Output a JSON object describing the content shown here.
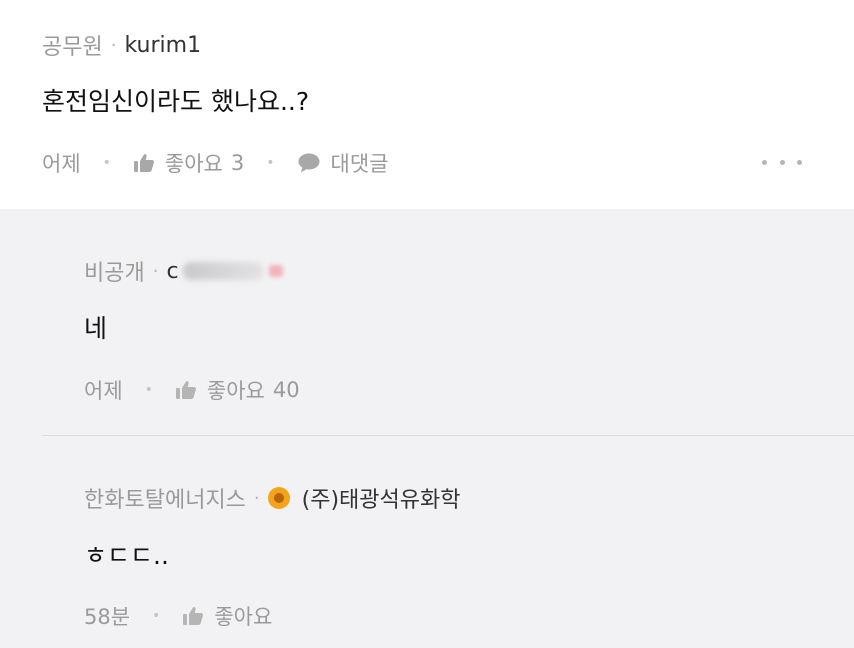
{
  "comment": {
    "job": "공무원",
    "author": "kurim1",
    "text": "혼전임신이라도 했나요..?",
    "time": "어제",
    "like_label": "좋아요",
    "like_count": "3",
    "reply_label": "대댓글",
    "more_icon": "more-dots-icon"
  },
  "replies": [
    {
      "company": "비공개",
      "author_visible": "c",
      "text": "네",
      "time": "어제",
      "like_label": "좋아요",
      "like_count": "40"
    },
    {
      "company": "한화토탈에너지스",
      "author": "(주)태광석유화학",
      "text": "ㅎㄷㄷ..",
      "time": "58분",
      "like_label": "좋아요",
      "like_count": ""
    }
  ],
  "icons": {
    "like": "thumbs-up-icon",
    "reply": "speech-bubble-icon",
    "company": "sun-badge-icon"
  },
  "colors": {
    "reply_background": "#f2f2f4",
    "muted_text": "#9a9a9a",
    "company_badge": "#f3a51a"
  }
}
